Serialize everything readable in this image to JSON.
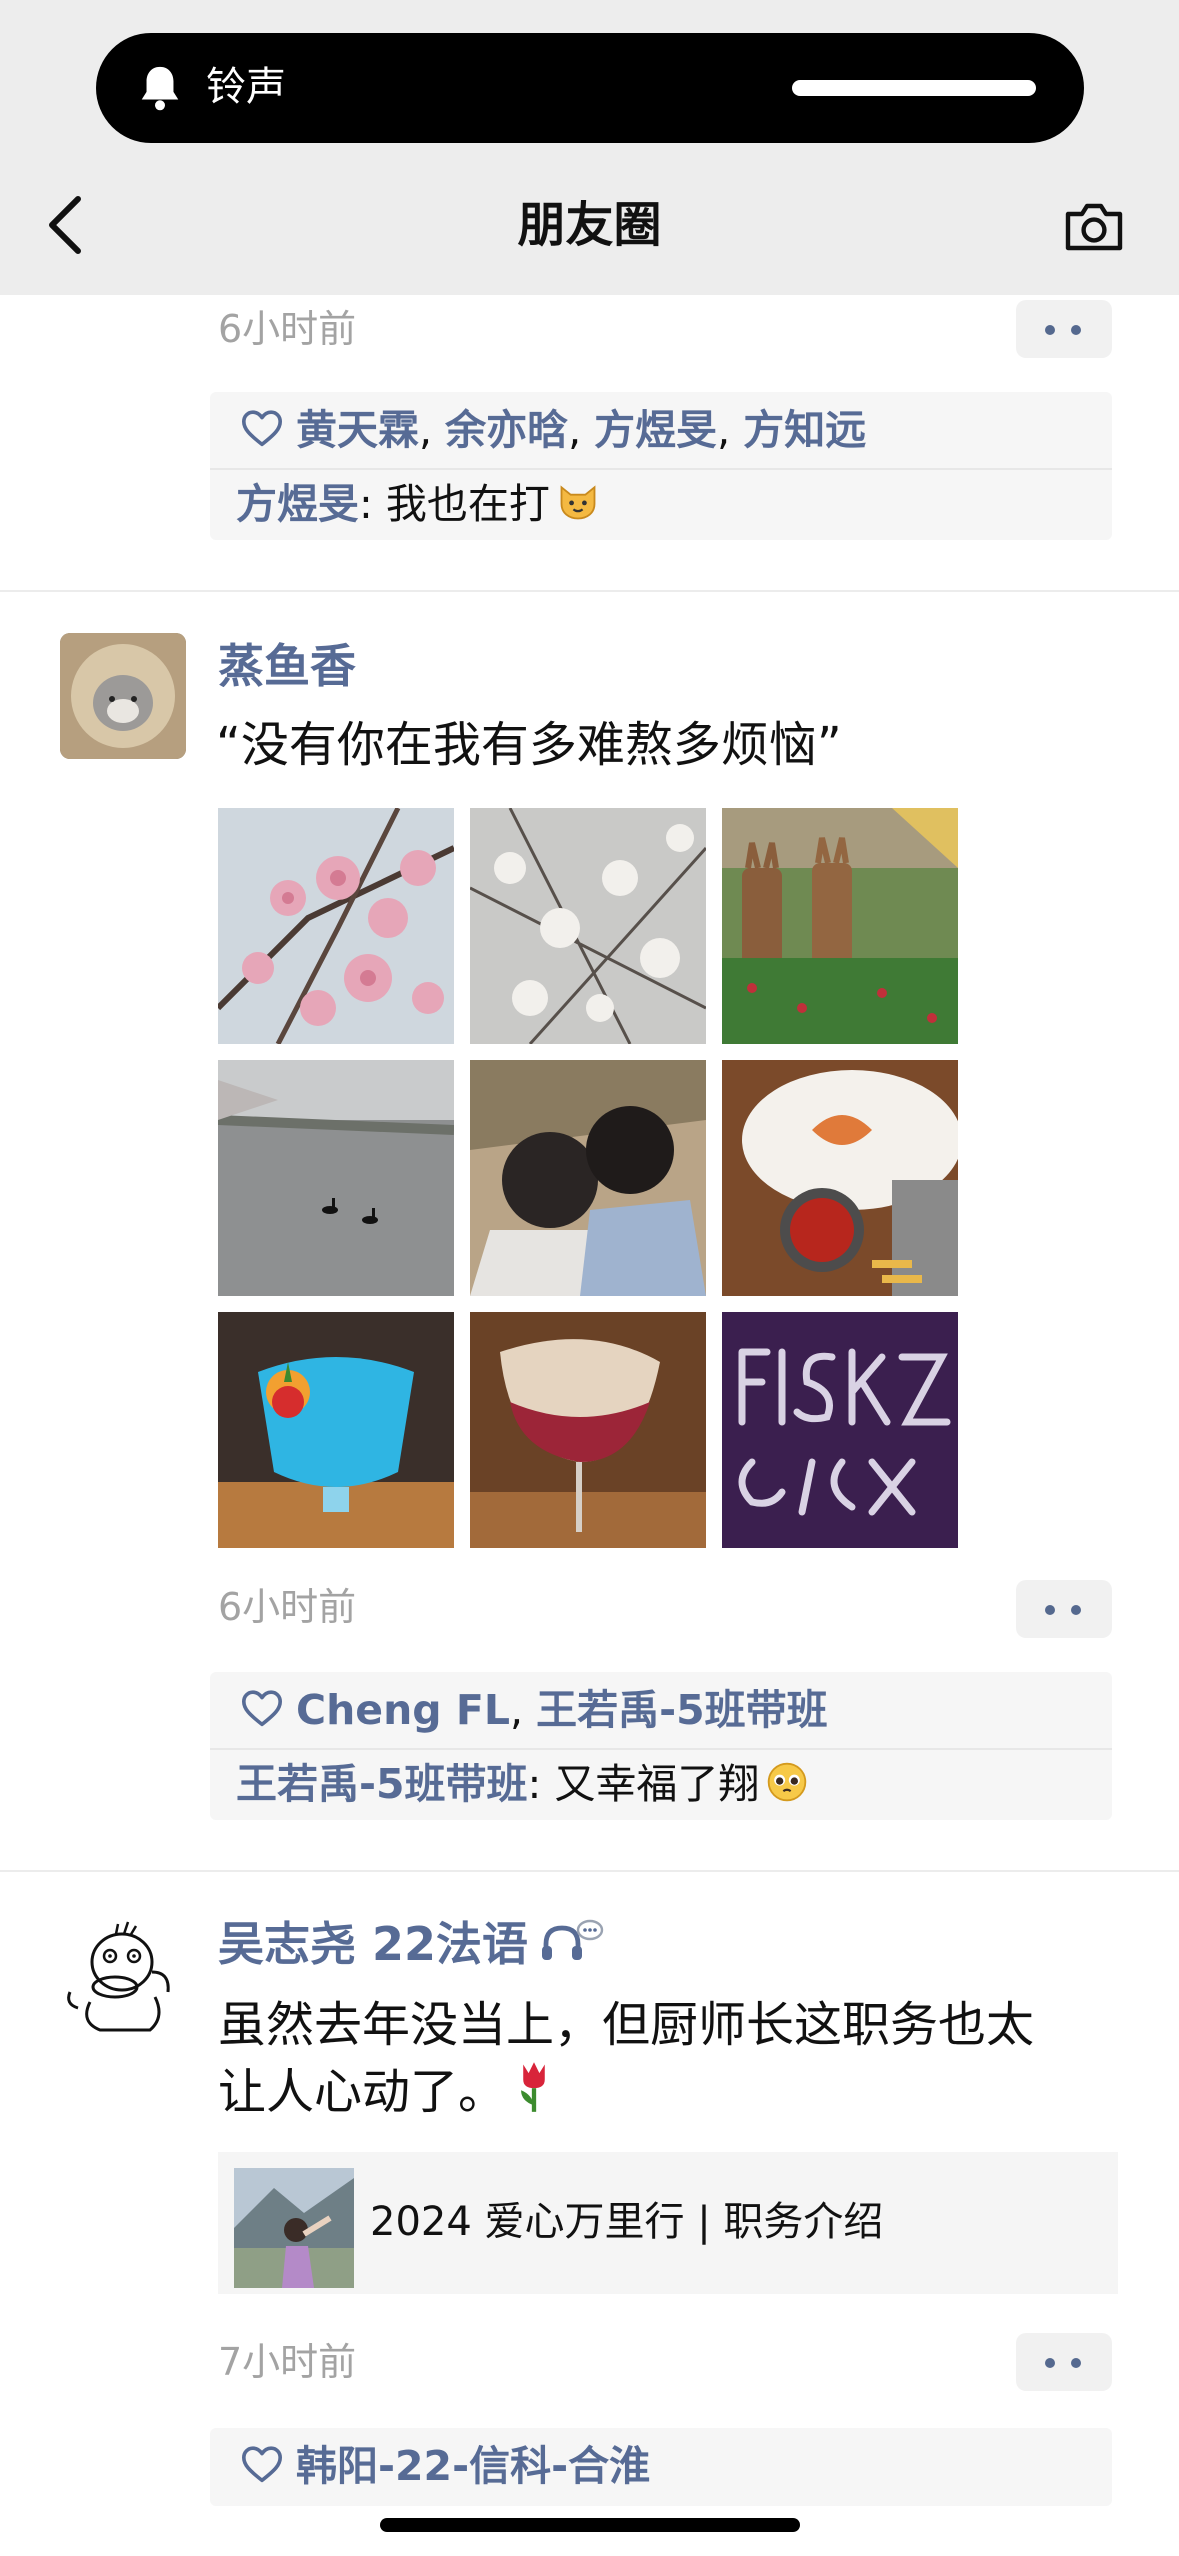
{
  "status_bar": {
    "notification_label": "铃声"
  },
  "nav": {
    "title": "朋友圈"
  },
  "post_prev": {
    "time": "6小时前",
    "likes": [
      "黄天霖",
      "余亦晗",
      "方煜旻",
      "方知远"
    ],
    "comment": {
      "author": "方煜旻",
      "text": "我也在打"
    }
  },
  "post1": {
    "author": "蒸鱼香",
    "text": "“没有你在我有多难熬多烦恼”",
    "photos": [
      "cherry-blossom",
      "white-blossom",
      "bunny-statues",
      "swans-lake",
      "couple",
      "plate-sauce",
      "blue-cocktail",
      "red-cocktail",
      "purple-glitter"
    ],
    "time": "6小时前",
    "likes": [
      "Cheng FL",
      "王若禹-5班带班"
    ],
    "comment": {
      "author": "王若禹-5班带班",
      "text": "又幸福了翔"
    }
  },
  "post2": {
    "author": "吴志尧 22法语",
    "text_line1": "虽然去年没当上，但厨师长这职务也太",
    "text_line2": "让人心动了。",
    "link_title": "2024 爱心万里行 | 职务介绍",
    "time": "7小时前",
    "likes": [
      "韩阳-22-信科-合淮"
    ]
  },
  "colors": {
    "link_blue": "#576b95",
    "time_gray": "#a3a3a3",
    "header_bg": "#ededed"
  }
}
